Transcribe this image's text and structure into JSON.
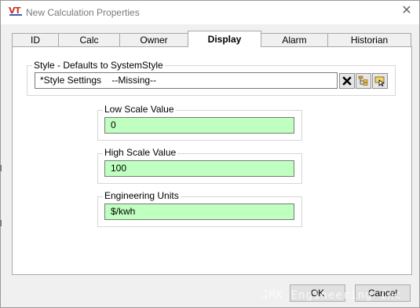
{
  "window": {
    "title": "New Calculation Properties",
    "logo_text": "VT"
  },
  "tabs": [
    {
      "label": "ID"
    },
    {
      "label": "Calc"
    },
    {
      "label": "Owner"
    },
    {
      "label": "Display",
      "active": true
    },
    {
      "label": "Alarm"
    },
    {
      "label": "Historian"
    }
  ],
  "style_group": {
    "label": "Style - Defaults to SystemStyle",
    "value": "*Style Settings    --Missing--",
    "buttons": [
      "clear-icon",
      "tree-browse-icon",
      "select-style-icon"
    ]
  },
  "low_scale": {
    "label": "Low Scale Value",
    "value": "0"
  },
  "high_scale": {
    "label": "High Scale Value",
    "value": "100"
  },
  "engineering_units": {
    "label": "Engineering Units",
    "value": "$/kwh"
  },
  "buttons": {
    "ok": "OK",
    "cancel": "Cancel"
  },
  "watermark": "JMK Engineering Inc",
  "colors": {
    "field_bg": "#bfffbf",
    "logo_red": "#d0302a"
  }
}
